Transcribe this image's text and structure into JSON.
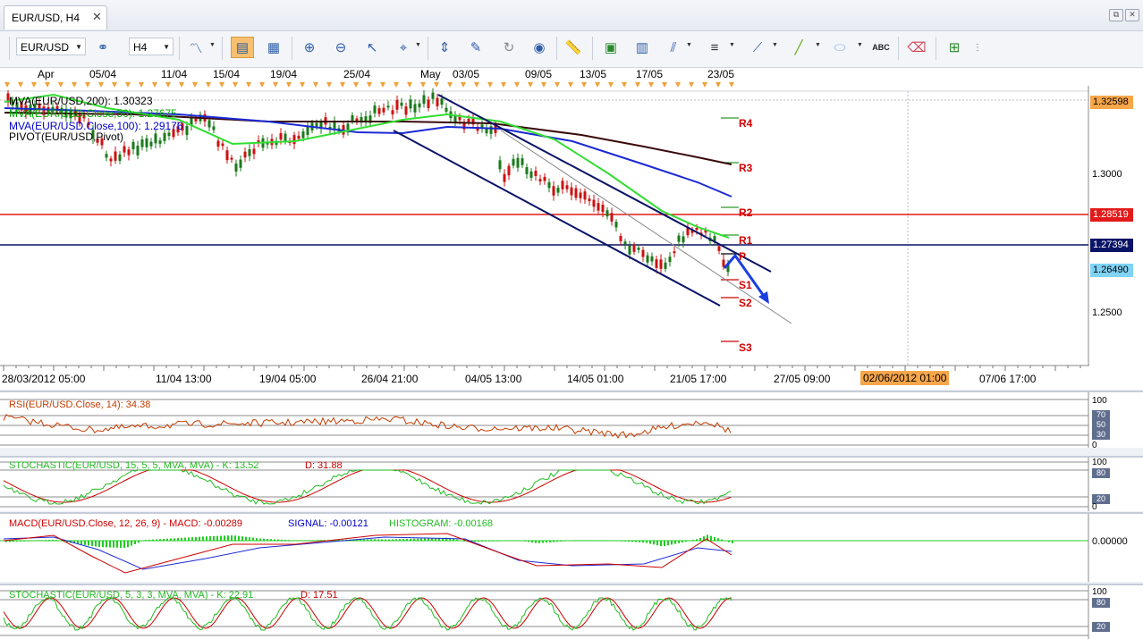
{
  "tab": {
    "title": "EUR/USD, H4",
    "close": "✕"
  },
  "window": {
    "restore": "⧉",
    "close": "✕"
  },
  "toolbar": {
    "symbol": "EUR/USD",
    "timeframe": "H4"
  },
  "top_dates": [
    "Apr",
    "05/04",
    "11/04",
    "15/04",
    "19/04",
    "25/04",
    "May",
    "03/05",
    "09/05",
    "13/05",
    "17/05",
    "23/05"
  ],
  "bottom_dates": [
    "28/03/2012 05:00",
    "11/04 13:00",
    "19/04 05:00",
    "26/04 21:00",
    "04/05 13:00",
    "14/05 01:00",
    "21/05 17:00",
    "27/05 09:00",
    "02/06/2012 01:00",
    "07/06 17:00"
  ],
  "legend": [
    {
      "text": "MVA(EUR/USD,200): 1.30323",
      "color": "#000000"
    },
    {
      "text": "MVA(EUR/USD.Close,50): 1.27675",
      "color": "#00aa00"
    },
    {
      "text": "MVA(EUR/USD.Close,100): 1.29176",
      "color": "#0000cc"
    },
    {
      "text": "PIVOT(EUR/USD,Pivot)",
      "color": "#000000"
    }
  ],
  "pivots": [
    "R4",
    "R3",
    "R2",
    "R1",
    "P",
    "S1",
    "S2",
    "S3"
  ],
  "price_axis": [
    "1.3000",
    "1.2500"
  ],
  "price_boxes": [
    {
      "value": "1.32598",
      "bg": "#f7a64a",
      "fg": "#000000"
    },
    {
      "value": "1.28519",
      "bg": "#e21a1a",
      "fg": "#ffffff"
    },
    {
      "value": "1.27394",
      "bg": "#0a1466",
      "fg": "#ffffff"
    },
    {
      "value": "1.26490",
      "bg": "#7fd3f5",
      "fg": "#000000"
    }
  ],
  "rsi": {
    "title": "RSI(EUR/USD.Close, 14): 34.38",
    "color": "#c43c00",
    "axis": [
      "100",
      "70",
      "50",
      "30",
      "0"
    ]
  },
  "stoch1": {
    "title": "STOCHASTIC(EUR/USD, 15, 5, 5, MVA, MVA)  -  K: 13.52",
    "d": "D: 31.88",
    "axis": [
      "100",
      "80",
      "20",
      "0"
    ]
  },
  "macd": {
    "title": "MACD(EUR/USD.Close, 12, 26, 9)  -  MACD: -0.00289",
    "signal": "SIGNAL: -0.00121",
    "hist": "HISTOGRAM: -0.00168",
    "axis": "0.00000"
  },
  "stoch2": {
    "title": "STOCHASTIC(EUR/USD, 5, 3, 3, MVA, MVA)  -  K: 22.91",
    "d": "D: 17.51",
    "axis": [
      "100",
      "80",
      "20"
    ]
  }
}
